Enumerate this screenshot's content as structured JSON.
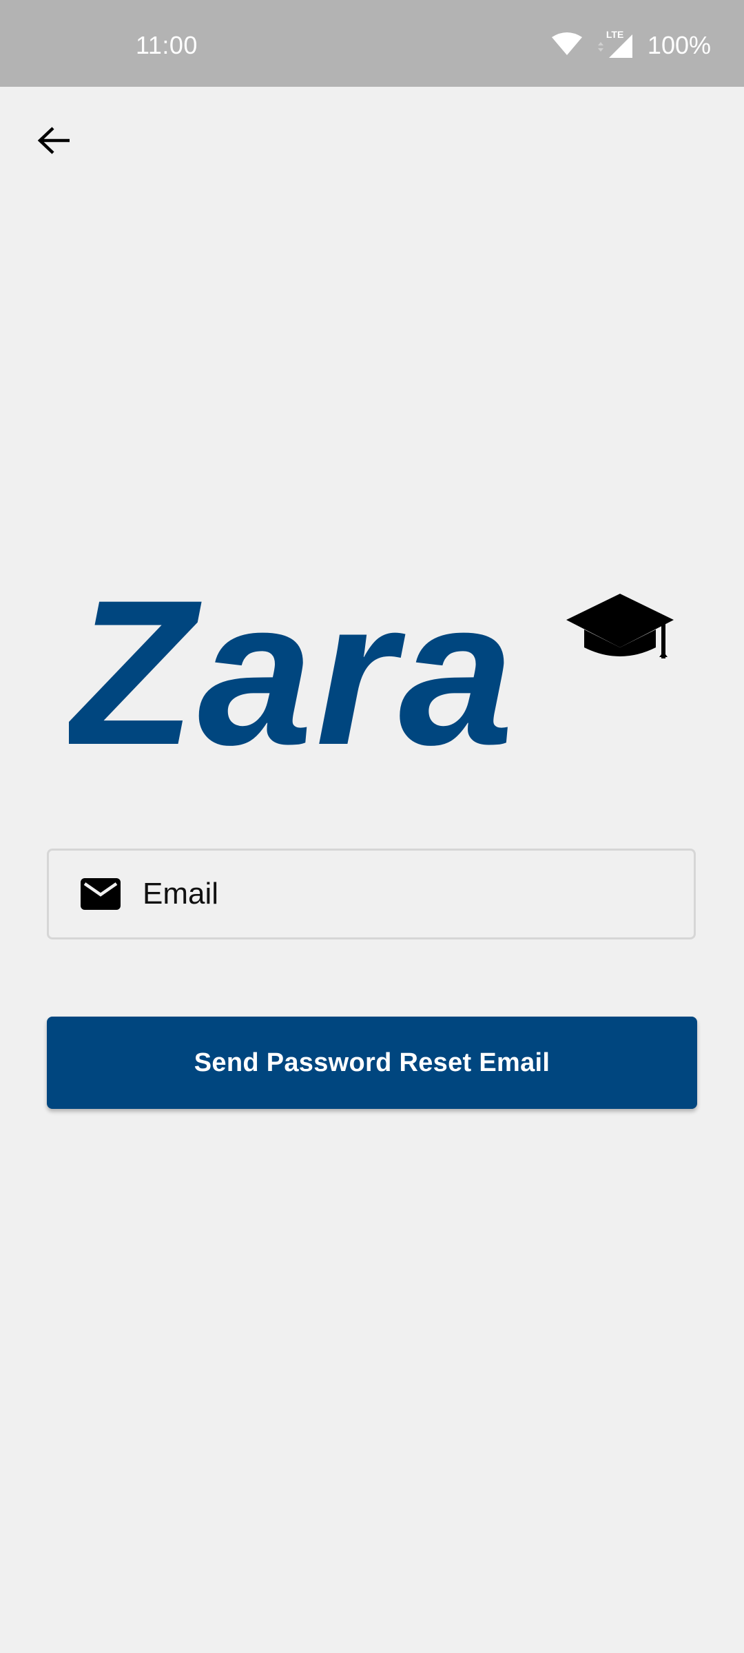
{
  "status_bar": {
    "time": "11:00",
    "battery": "100%",
    "network_label": "LTE",
    "background_color": "#b3b3b3",
    "icons": [
      "wifi-icon",
      "signal-icon",
      "battery-icon"
    ]
  },
  "header": {
    "back_icon": "arrow-left-icon"
  },
  "logo": {
    "text": "Zara",
    "color": "#00467f",
    "icon": "graduation-cap-icon"
  },
  "form": {
    "email": {
      "placeholder": "Email",
      "value": "",
      "icon": "envelope-icon"
    },
    "submit_label": "Send Password Reset Email",
    "submit_color": "#00467f"
  },
  "colors": {
    "background": "#f0f0f0",
    "accent": "#00467f",
    "input_border": "#d6d6d6"
  }
}
